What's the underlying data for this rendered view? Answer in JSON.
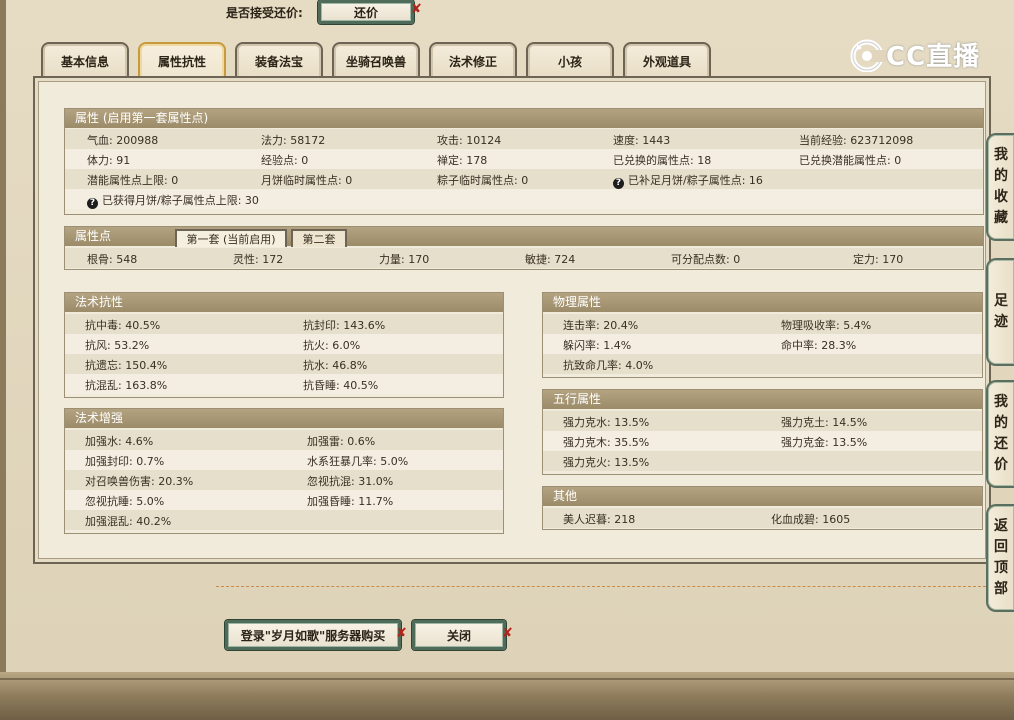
{
  "offer": {
    "label": "是否接受还价:",
    "button": "还价"
  },
  "tabs": [
    "基本信息",
    "属性抗性",
    "装备法宝",
    "坐骑召唤兽",
    "法术修正",
    "小孩",
    "外观道具"
  ],
  "logo": {
    "text": "CC直播"
  },
  "attributes": {
    "header": "属性 (启用第一套属性点)",
    "rows": [
      [
        "气血: 200988",
        "法力: 58172",
        "攻击: 10124",
        "速度: 1443",
        "当前经验: 623712098"
      ],
      [
        "体力: 91",
        "经验点: 0",
        "禅定: 178",
        "已兑换的属性点: 18",
        "已兑换潜能属性点: 0"
      ],
      [
        "潜能属性点上限: 0",
        "月饼临时属性点: 0",
        "粽子临时属性点: 0",
        "已补足月饼/粽子属性点: 16",
        ""
      ],
      [
        "已获得月饼/粽子属性点上限: 30",
        "",
        "",
        "",
        ""
      ]
    ]
  },
  "attr_points": {
    "header": "属性点",
    "tab1": "第一套 (当前启用)",
    "tab2": "第二套",
    "row": [
      "根骨: 548",
      "灵性: 172",
      "力量: 170",
      "敏捷: 724",
      "可分配点数: 0",
      "定力: 170"
    ]
  },
  "magic_resist": {
    "header": "法术抗性",
    "rows": [
      [
        "抗中毒: 40.5%",
        "抗封印: 143.6%"
      ],
      [
        "抗风: 53.2%",
        "抗火: 6.0%"
      ],
      [
        "抗遗忘: 150.4%",
        "抗水: 46.8%"
      ],
      [
        "抗混乱: 163.8%",
        "抗昏睡: 40.5%"
      ]
    ]
  },
  "magic_boost": {
    "header": "法术增强",
    "rows": [
      [
        "加强水: 4.6%",
        "加强雷: 0.6%"
      ],
      [
        "加强封印: 0.7%",
        "水系狂暴几率: 5.0%"
      ],
      [
        "对召唤兽伤害: 20.3%",
        "忽视抗混: 31.0%"
      ],
      [
        "忽视抗睡: 5.0%",
        "加强昏睡: 11.7%"
      ],
      [
        "加强混乱: 40.2%",
        ""
      ]
    ]
  },
  "physical": {
    "header": "物理属性",
    "rows": [
      [
        "连击率: 20.4%",
        "物理吸收率: 5.4%"
      ],
      [
        "躲闪率: 1.4%",
        "命中率: 28.3%"
      ],
      [
        "抗致命几率: 4.0%",
        ""
      ]
    ]
  },
  "five_elements": {
    "header": "五行属性",
    "rows": [
      [
        "强力克水: 13.5%",
        "强力克土: 14.5%"
      ],
      [
        "强力克木: 35.5%",
        "强力克金: 13.5%"
      ],
      [
        "强力克火: 13.5%",
        ""
      ]
    ]
  },
  "other": {
    "header": "其他",
    "rows": [
      [
        "美人迟暮: 218",
        "化血成碧: 1605"
      ]
    ]
  },
  "bottom_buttons": {
    "login": "登录\"岁月如歌\"服务器购买",
    "close": "关闭"
  },
  "side_buttons": [
    [
      "我",
      "的",
      "收",
      "藏"
    ],
    [
      "足",
      "迹"
    ],
    [
      "我",
      "的",
      "还",
      "价"
    ],
    [
      "返",
      "回",
      "顶",
      "部"
    ]
  ],
  "colors": {
    "accent": "#c79a3e",
    "header": "#a89675",
    "green_border": "#4f6b59",
    "close_x": "#b3251b"
  }
}
